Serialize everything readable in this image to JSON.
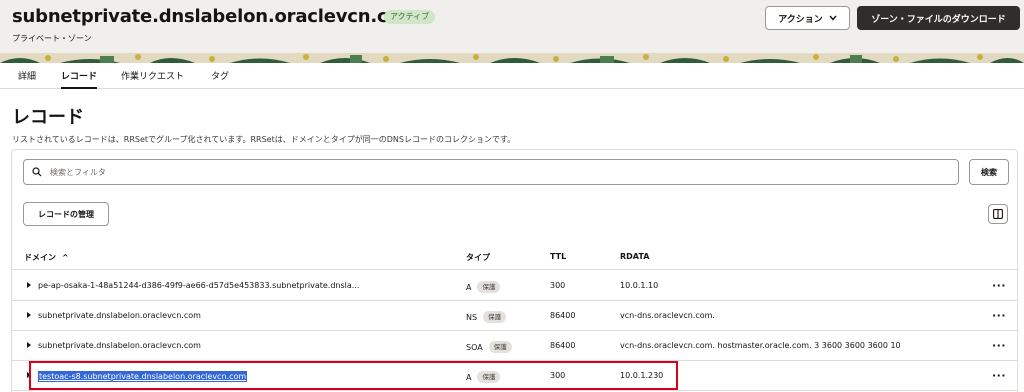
{
  "header": {
    "zone_name": "subnetprivate.dnslabelon.oraclevcn.com",
    "status": "アクティブ",
    "subtitle": "プライベート・ゾーン",
    "actions_label": "アクション",
    "download_label": "ゾーン・ファイルのダウンロード",
    "status_color": "#cfe6c8",
    "decor_colors": [
      "#2f5d3a",
      "#c7b13b",
      "#4e7d4f",
      "#e2d9c0"
    ]
  },
  "tabs": [
    {
      "label": "詳細",
      "active": false
    },
    {
      "label": "レコード",
      "active": true
    },
    {
      "label": "作業リクエスト",
      "active": false
    },
    {
      "label": "タグ",
      "active": false
    }
  ],
  "page": {
    "title": "レコード",
    "description": "リストされているレコードは、RRSetでグループ化されています。RRSetは、ドメインとタイプが同一のDNSレコードのコレクションです。"
  },
  "search": {
    "placeholder": "検索とフィルタ",
    "value": "",
    "button_label": "検索"
  },
  "toolbar": {
    "manage_label": "レコードの管理",
    "columns_icon": "columns-icon"
  },
  "table": {
    "columns": [
      "ドメイン",
      "タイプ",
      "TTL",
      "RDATA"
    ],
    "sort_indicator": "^",
    "rows": [
      {
        "domain": "pe-ap-osaka-1-48a51244-d386-49f9-ae66-d57d5e453833.subnetprivate.dnsla...",
        "type": "A",
        "badge": "保護",
        "ttl": "300",
        "rdata": "10.0.1.10"
      },
      {
        "domain": "subnetprivate.dnslabelon.oraclevcn.com",
        "type": "NS",
        "badge": "保護",
        "ttl": "86400",
        "rdata": "vcn-dns.oraclevcn.com."
      },
      {
        "domain": "subnetprivate.dnslabelon.oraclevcn.com",
        "type": "SOA",
        "badge": "保護",
        "ttl": "86400",
        "rdata": "vcn-dns.oraclevcn.com. hostmaster.oracle.com. 3 3600 3600 3600 10"
      },
      {
        "domain": "testoac-s8.subnetprivate.dnslabelon.oraclevcn.com",
        "type": "A",
        "badge": "保護",
        "ttl": "300",
        "rdata": "10.0.1.230"
      }
    ],
    "more_label": "···",
    "highlight_color": "#d9001b",
    "selection_color": "#3367d6"
  }
}
